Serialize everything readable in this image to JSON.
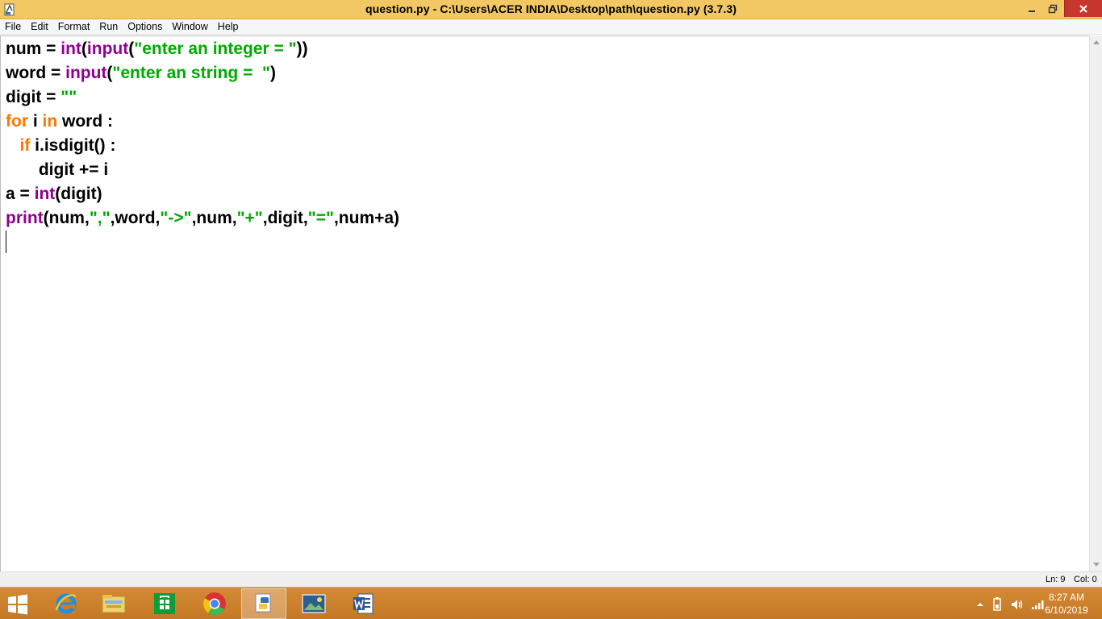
{
  "window": {
    "title": "question.py - C:\\Users\\ACER INDIA\\Desktop\\path\\question.py (3.7.3)"
  },
  "menu": [
    "File",
    "Edit",
    "Format",
    "Run",
    "Options",
    "Window",
    "Help"
  ],
  "code": {
    "lines": [
      [
        {
          "t": "num = ",
          "c": ""
        },
        {
          "t": "int",
          "c": "bi"
        },
        {
          "t": "(",
          "c": ""
        },
        {
          "t": "input",
          "c": "bi"
        },
        {
          "t": "(",
          "c": ""
        },
        {
          "t": "\"enter an integer = \"",
          "c": "str"
        },
        {
          "t": "))",
          "c": ""
        }
      ],
      [
        {
          "t": "word = ",
          "c": ""
        },
        {
          "t": "input",
          "c": "bi"
        },
        {
          "t": "(",
          "c": ""
        },
        {
          "t": "\"enter an string =  \"",
          "c": "str"
        },
        {
          "t": ")",
          "c": ""
        }
      ],
      [
        {
          "t": "digit = ",
          "c": ""
        },
        {
          "t": "\"\"",
          "c": "str"
        }
      ],
      [
        {
          "t": "for",
          "c": "kw"
        },
        {
          "t": " i ",
          "c": ""
        },
        {
          "t": "in",
          "c": "kw"
        },
        {
          "t": " word :",
          "c": ""
        }
      ],
      [
        {
          "t": "   ",
          "c": ""
        },
        {
          "t": "if",
          "c": "kw"
        },
        {
          "t": " i.isdigit() :",
          "c": ""
        }
      ],
      [
        {
          "t": "       digit += i",
          "c": ""
        }
      ],
      [
        {
          "t": "a = ",
          "c": ""
        },
        {
          "t": "int",
          "c": "bi"
        },
        {
          "t": "(digit)",
          "c": ""
        }
      ],
      [
        {
          "t": "print",
          "c": "bi"
        },
        {
          "t": "(num,",
          "c": ""
        },
        {
          "t": "\",\"",
          "c": "str"
        },
        {
          "t": ",word,",
          "c": ""
        },
        {
          "t": "\"->\"",
          "c": "str"
        },
        {
          "t": ",num,",
          "c": ""
        },
        {
          "t": "\"+\"",
          "c": "str"
        },
        {
          "t": ",digit,",
          "c": ""
        },
        {
          "t": "\"=\"",
          "c": "str"
        },
        {
          "t": ",num+a)",
          "c": ""
        }
      ]
    ]
  },
  "status": {
    "line": "Ln: 9",
    "column": "Col: 0"
  },
  "taskbar": {
    "apps": [
      "internet-explorer",
      "file-explorer",
      "store",
      "chrome",
      "python-idle",
      "photos",
      "word"
    ],
    "active_app": "python-idle"
  },
  "clock": {
    "time": "8:27 AM",
    "date": "6/10/2019"
  },
  "colors": {
    "title_bar": "#f2c864",
    "keyword": "#ff7700",
    "builtin": "#900090",
    "string": "#00aa00",
    "taskbar": "#c97d2c",
    "close_button": "#c7372e"
  }
}
